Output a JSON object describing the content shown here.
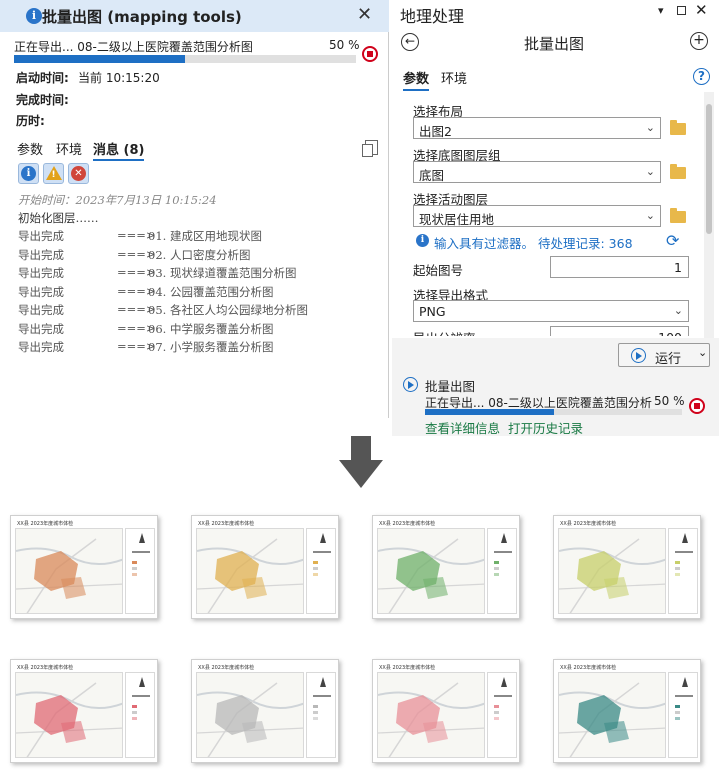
{
  "left_dialog": {
    "title": "批量出图 (mapping tools)",
    "progress_text": "正在导出...   08-二级以上医院覆盖范围分析图",
    "progress_percent_text": "50 %",
    "progress_fraction": 0.5,
    "start_label": "启动时间:",
    "start_value": "当前 10:15:20",
    "finish_label": "完成时间:",
    "elapsed_label": "历时:",
    "tabs": [
      "参数",
      "环境",
      "消息 (8)"
    ],
    "log_header": "开始时间：2023年7月13日 10:15:24",
    "log_init": "初始化图层……",
    "log_rows": [
      {
        "status": "导出完成",
        "arrow": "===>",
        "item": "01. 建成区用地现状图"
      },
      {
        "status": "导出完成",
        "arrow": "===>",
        "item": "02. 人口密度分析图"
      },
      {
        "status": "导出完成",
        "arrow": "===>",
        "item": "03. 现状绿道覆盖范围分析图"
      },
      {
        "status": "导出完成",
        "arrow": "===>",
        "item": "04. 公园覆盖范围分析图"
      },
      {
        "status": "导出完成",
        "arrow": "===>",
        "item": "05. 各社区人均公园绿地分析图"
      },
      {
        "status": "导出完成",
        "arrow": "===>",
        "item": "06. 中学服务覆盖分析图"
      },
      {
        "status": "导出完成",
        "arrow": "===>",
        "item": "07. 小学服务覆盖分析图"
      }
    ]
  },
  "right_pane": {
    "title": "地理处理",
    "tool_name": "批量出图",
    "tabs": [
      "参数",
      "环境"
    ],
    "select_layout_label": "选择布局",
    "select_layout_value": "出图2",
    "select_base_label": "选择底图图层组",
    "select_base_value": "底图",
    "select_active_label": "选择活动图层",
    "select_active_value": "现状居住用地",
    "filter_note": "输入具有过滤器。 待处理记录: 368",
    "start_no_label": "起始图号",
    "start_no_value": "1",
    "format_label": "选择导出格式",
    "format_value": "PNG",
    "resolution_label": "导出分辨率",
    "resolution_value": "100",
    "run_label": "运行",
    "status_tool": "批量出图",
    "status_progress": "正在导出...   08-二级以上医院覆盖范围分析",
    "status_percent": "50 %",
    "status_fraction": 0.5,
    "link_details": "查看详细信息",
    "link_history": "打开历史记录"
  },
  "thumbnails": [
    {
      "title": "XX县 2023年度城市体检",
      "theme": "#d98a5a"
    },
    {
      "title": "XX县 2023年度城市体检",
      "theme": "#e0b050"
    },
    {
      "title": "XX县 2023年度城市体检",
      "theme": "#6fb06a"
    },
    {
      "title": "XX县 2023年度城市体检",
      "theme": "#c7cf6a"
    },
    {
      "title": "XX县 2023年度城市体检",
      "theme": "#e06a74"
    },
    {
      "title": "XX县 2023年度城市体检",
      "theme": "#b8b8b8"
    },
    {
      "title": "XX县 2023年度城市体检",
      "theme": "#e89098"
    },
    {
      "title": "XX县 2023年度城市体检",
      "theme": "#3a8a86"
    }
  ],
  "colors": {
    "accent": "#1e6fc4",
    "stop": "#d0021b",
    "link": "#1a7a45",
    "title_bar": "#dce9f7"
  }
}
